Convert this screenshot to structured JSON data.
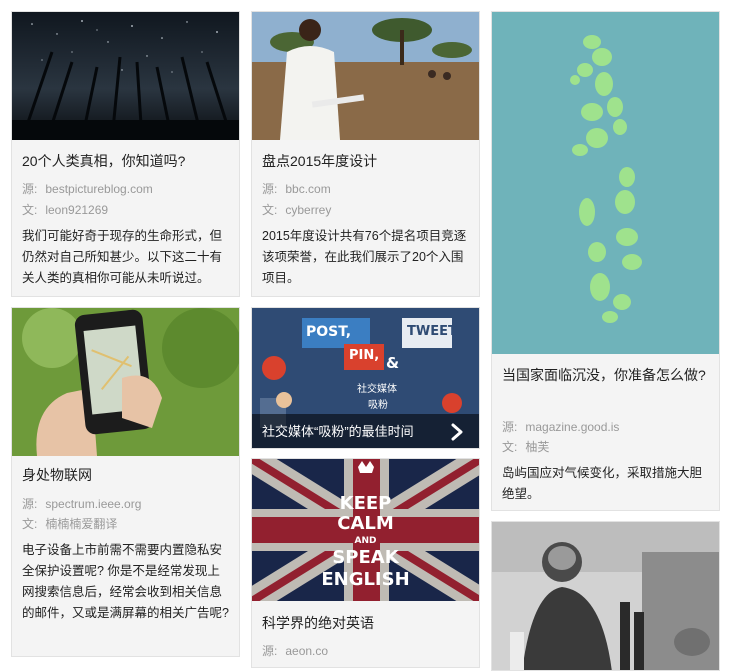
{
  "cards": [
    {
      "title": "20个人类真相，你知道吗?",
      "source_label": "源:",
      "source": "bestpictureblog.com",
      "author_label": "文:",
      "author": "leon921269",
      "desc": "我们可能好奇于现存的生命形式，但仍然对自己所知甚少。以下这二十有关人类的真相你可能从未听说过。"
    },
    {
      "title": "盘点2015年度设计",
      "source_label": "源:",
      "source": "bbc.com",
      "author_label": "文:",
      "author": "cyberrey",
      "desc": "2015年度设计共有76个提名项目竞逐该项荣誉，在此我们展示了20个入围项目。"
    },
    {
      "title": "当国家面临沉没，你准备怎么做?",
      "source_label": "源:",
      "source": "magazine.good.is",
      "author_label": "文:",
      "author": "柚芙",
      "desc": "岛屿国应对气候变化，采取措施大胆绝望。"
    },
    {
      "title": "身处物联网",
      "source_label": "源:",
      "source": "spectrum.ieee.org",
      "author_label": "文:",
      "author": "楠楠楠爱翻译",
      "desc": "电子设备上市前需不需要内置隐私安全保护设置呢? 你是不是经常发现上网搜索信息后，经常会收到相关信息的邮件，又或是满屏幕的相关广告呢?"
    },
    {
      "title": "社交媒体“吸粉”的最佳时间",
      "poster": {
        "post": "POST,",
        "pin": "PIN,",
        "amp": "&",
        "tweet": "TWEET",
        "social": "社交媒体",
        "fans": "吸粉"
      }
    },
    {
      "title": "科学界的绝对英语",
      "source_label": "源:",
      "source": "aeon.co",
      "poster": {
        "l1": "KEEP",
        "l2": "CALM",
        "l3": "AND",
        "l4": "SPEAK",
        "l5": "ENGLISH"
      }
    }
  ]
}
